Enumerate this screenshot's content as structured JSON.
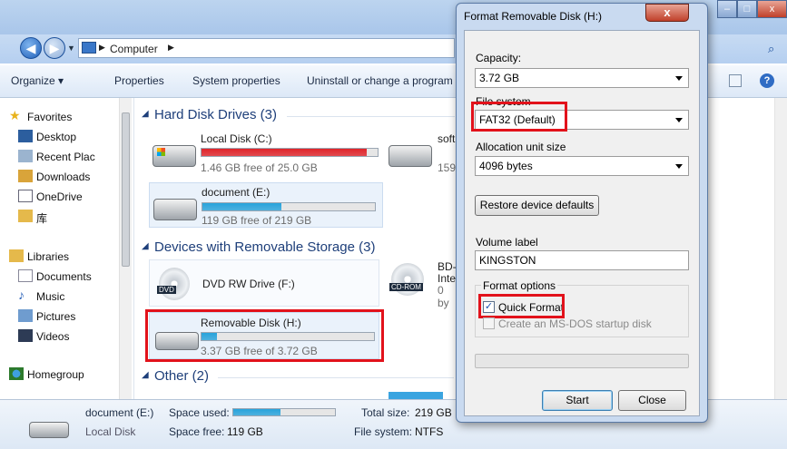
{
  "explorer": {
    "breadcrumb": [
      "Computer"
    ],
    "toolbar": [
      "Organize ▾",
      "Properties",
      "System properties",
      "Uninstall or change a program"
    ],
    "nav": {
      "favorites": [
        "Favorites",
        "Desktop",
        "Recent Plac",
        "Downloads",
        "OneDrive",
        "库"
      ],
      "libraries": [
        "Libraries",
        "Documents",
        "Music",
        "Pictures",
        "Videos"
      ],
      "homegroup": "Homegroup"
    },
    "groups": {
      "hdd": "Hard Disk Drives (3)",
      "removable": "Devices with Removable Storage (3)",
      "other": "Other (2)"
    },
    "drives": [
      {
        "name": "Local Disk (C:)",
        "free": "1.46 GB free of 25.0 GB",
        "used_fraction": 0.94,
        "color": "#e0242a"
      },
      {
        "name": "document (E:)",
        "free": "119 GB free of 219 GB",
        "used_fraction": 0.46,
        "color": "#27a3dc"
      },
      {
        "name": "Removable Disk (H:)",
        "free": "3.37 GB free of 3.72 GB",
        "used_fraction": 0.09,
        "color": "#27a3dc"
      }
    ],
    "partial": {
      "soft": "soft",
      "soft_free": "159",
      "bd_1": "BD-",
      "bd_2": "Inte",
      "bd_3": "0 by"
    },
    "dvd": {
      "name": "DVD RW Drive (F:)",
      "icon_text": "DVD"
    },
    "cdrom": "CD-ROM",
    "status": {
      "name": "document (E:)",
      "type": "Local Disk",
      "used_label": "Space used:",
      "free_label": "Space free:",
      "free_value": "119 GB",
      "total_label": "Total size:",
      "total_value": "219 GB",
      "fs_label": "File system:",
      "fs_value": "NTFS"
    }
  },
  "dialog": {
    "title": "Format Removable Disk (H:)",
    "close": "x",
    "capacity_label": "Capacity:",
    "capacity_value": "3.72 GB",
    "fs_label": "File system",
    "fs_value": "FAT32 (Default)",
    "alloc_label": "Allocation unit size",
    "alloc_value": "4096 bytes",
    "restore_button": "Restore device defaults",
    "volume_label": "Volume label",
    "volume_value": "KINGSTON",
    "options_label": "Format options",
    "quick_format": "Quick Format",
    "quick_format_checked": true,
    "msdos": "Create an MS-DOS startup disk",
    "start_button": "Start",
    "close_button": "Close"
  },
  "colors": {
    "highlight": "#e2121b",
    "accent": "#1e3f7a"
  }
}
